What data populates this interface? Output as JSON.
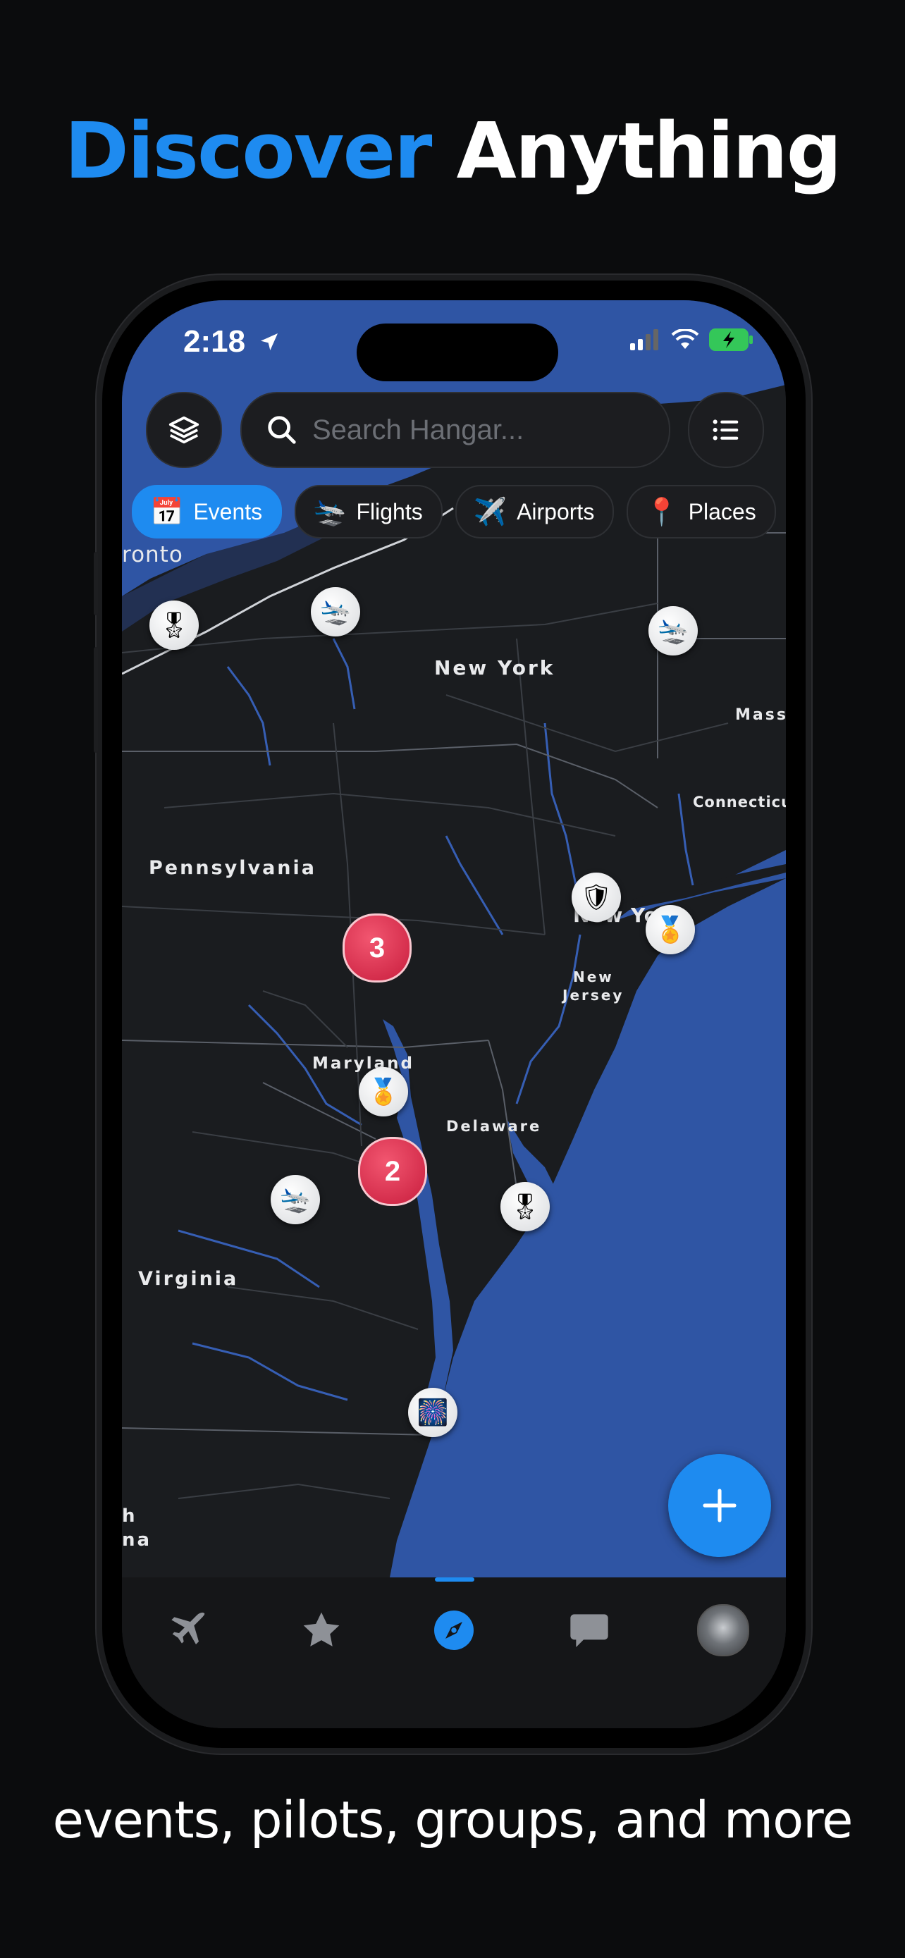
{
  "headline": {
    "word1": "Discover",
    "word2": "Anything"
  },
  "tagline": "events, pilots, groups, and more",
  "status": {
    "time": "2:18"
  },
  "search": {
    "placeholder": "Search Hangar..."
  },
  "chips": [
    {
      "emoji": "📅",
      "label": "Events",
      "active": true
    },
    {
      "emoji": "🛬",
      "label": "Flights",
      "active": false
    },
    {
      "emoji": "✈️",
      "label": "Airports",
      "active": false
    },
    {
      "emoji": "📍",
      "label": "Places",
      "active": false
    }
  ],
  "map_labels": {
    "toronto": "ronto",
    "new_york": "New York",
    "mass": "Mass",
    "connecticut": "Connecticut",
    "pennsylvania": "Pennsylvania",
    "new_york_city": "New Yo",
    "new_jersey_1": "New",
    "new_jersey_2": "Jersey",
    "maryland": "Maryland",
    "delaware": "Delaware",
    "virginia": "Virginia",
    "nc_1": "h",
    "nc_2": "na"
  },
  "clusters": {
    "a": "3",
    "b": "2"
  },
  "pins": {
    "medal": "🎖",
    "gold_medal": "🏅",
    "plane": "🛬",
    "shield": "🛡",
    "fireworks": "🎆"
  },
  "colors": {
    "accent": "#1e8bf0",
    "water": "#2f55a4",
    "land": "#1a1c1f",
    "cluster": "#d9304e"
  },
  "tabs": [
    "airplane-icon",
    "star-icon",
    "compass-icon",
    "chat-icon",
    "avatar"
  ]
}
